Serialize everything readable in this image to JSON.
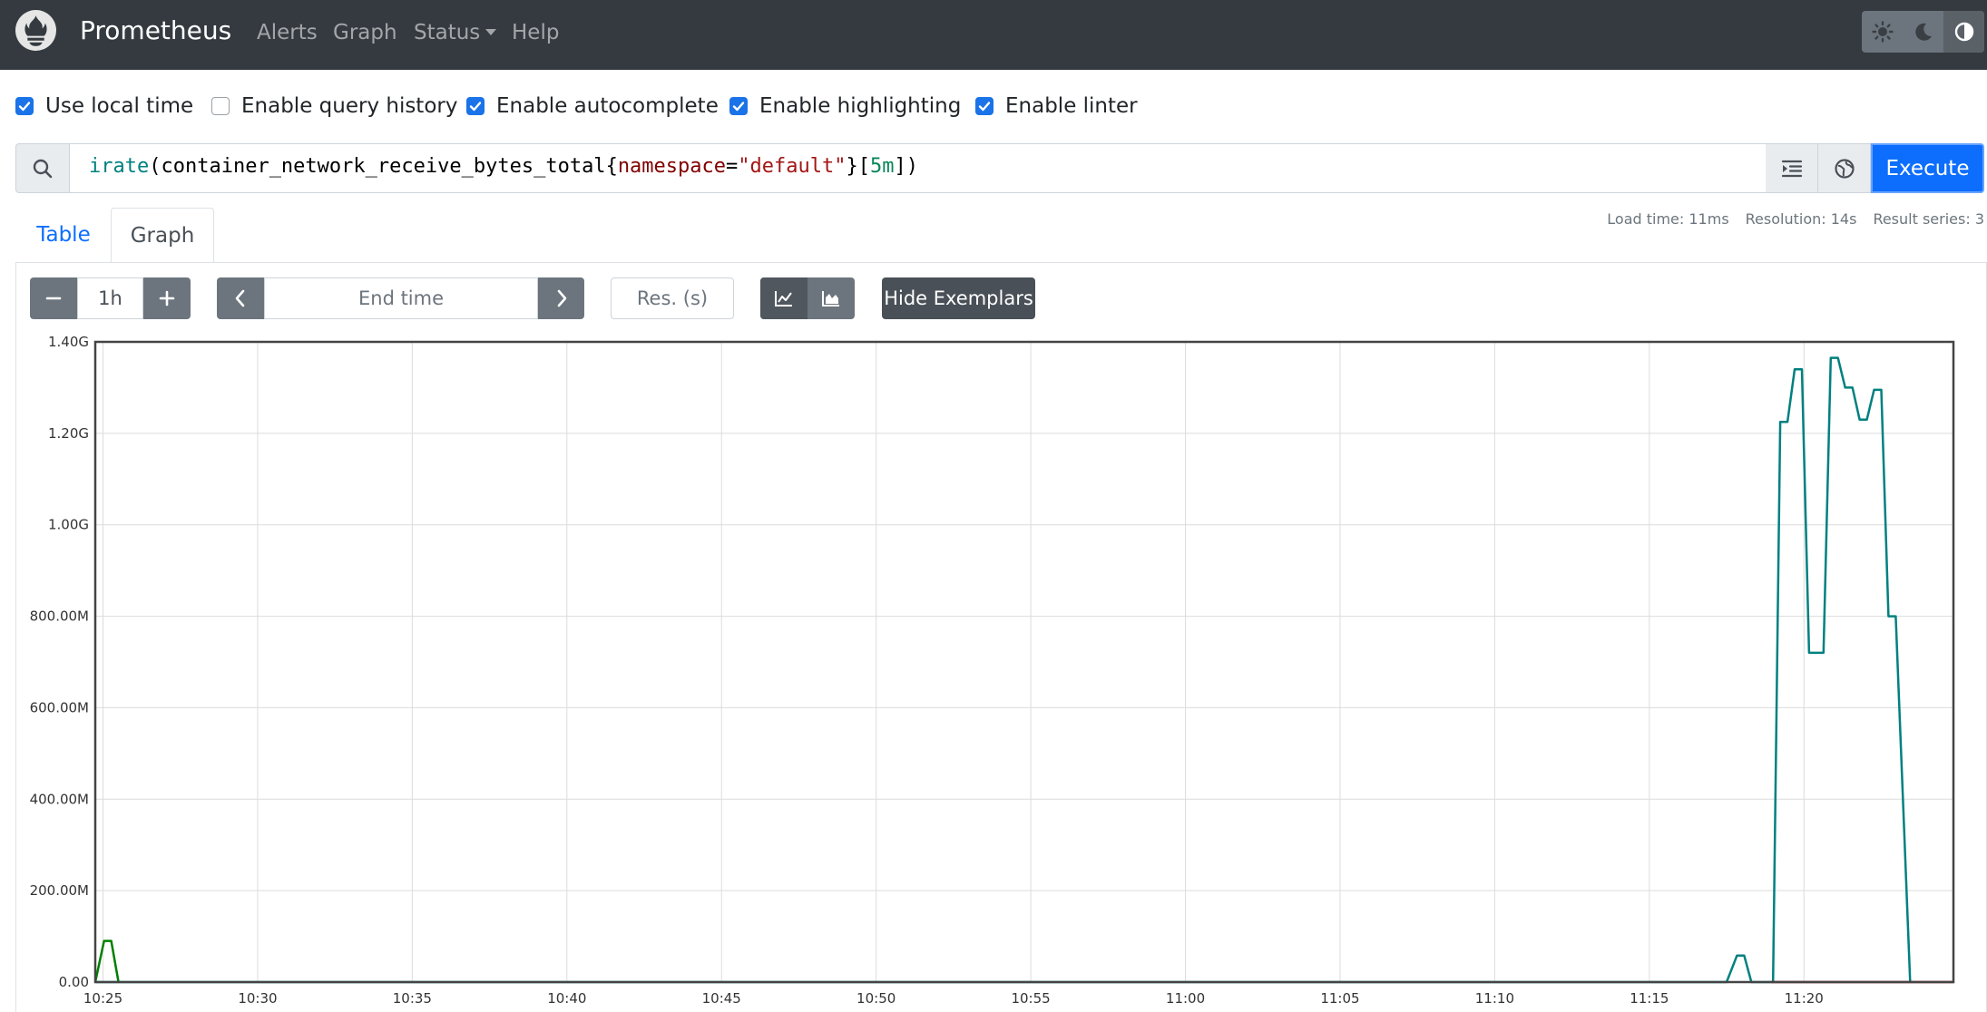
{
  "navbar": {
    "brand": "Prometheus",
    "links": [
      {
        "label": "Alerts"
      },
      {
        "label": "Graph"
      },
      {
        "label": "Status"
      },
      {
        "label": "Help"
      }
    ],
    "theme_buttons": [
      "sun-icon",
      "moon-icon",
      "contrast-icon"
    ],
    "active_theme": "contrast-icon"
  },
  "options": [
    {
      "label": "Use local time",
      "checked": true
    },
    {
      "label": "Enable query history",
      "checked": false
    },
    {
      "label": "Enable autocomplete",
      "checked": true
    },
    {
      "label": "Enable highlighting",
      "checked": true
    },
    {
      "label": "Enable linter",
      "checked": true
    }
  ],
  "query": {
    "fn": "irate",
    "open_paren": "(",
    "metric": "container_network_receive_bytes_total",
    "open_brace": "{",
    "label_name": "namespace",
    "eq": "=",
    "label_value": "\"default\"",
    "close_brace": "}",
    "open_bracket": "[",
    "range": "5m",
    "close": "])",
    "execute_label": "Execute"
  },
  "tabs": {
    "table": "Table",
    "graph": "Graph",
    "active": "graph"
  },
  "stats": {
    "load_time": "Load time: 11ms",
    "resolution": "Resolution: 14s",
    "result_series": "Result series: 3"
  },
  "controls": {
    "minus": "−",
    "range": "1h",
    "plus": "+",
    "end_time_placeholder": "End time",
    "res_placeholder": "Res. (s)",
    "hide_exemplars": "Hide Exemplars"
  },
  "chart_data": {
    "type": "line",
    "ylim": [
      0,
      1.4
    ],
    "y_unit": "G",
    "y_ticks": [
      "0.00",
      "200.00M",
      "400.00M",
      "600.00M",
      "800.00M",
      "1.00G",
      "1.20G",
      "1.40G"
    ],
    "x_ticks": [
      "10:25",
      "10:30",
      "10:35",
      "10:40",
      "10:45",
      "10:50",
      "10:55",
      "11:00",
      "11:05",
      "11:10",
      "11:15",
      "11:20"
    ],
    "xlim": [
      "10:24:45",
      "11:24:50"
    ],
    "grid": true,
    "series": [
      {
        "color": "#008000",
        "points": [
          [
            "10:24:45",
            0
          ],
          [
            "10:25:02",
            0.09
          ],
          [
            "10:25:16",
            0.09
          ],
          [
            "10:25:30",
            0
          ]
        ]
      },
      {
        "color": "#008080",
        "points": [
          [
            "10:24:45",
            0
          ],
          [
            "11:17:30",
            0
          ],
          [
            "11:17:50",
            0.058
          ],
          [
            "11:18:04",
            0.058
          ],
          [
            "11:18:18",
            0
          ],
          [
            "11:19:00",
            0
          ],
          [
            "11:19:14",
            1.225
          ],
          [
            "11:19:28",
            1.225
          ],
          [
            "11:19:42",
            1.34
          ],
          [
            "11:19:56",
            1.34
          ],
          [
            "11:20:10",
            0.72
          ],
          [
            "11:20:38",
            0.72
          ],
          [
            "11:20:52",
            1.365
          ],
          [
            "11:21:06",
            1.365
          ],
          [
            "11:21:20",
            1.3
          ],
          [
            "11:21:34",
            1.3
          ],
          [
            "11:21:48",
            1.23
          ],
          [
            "11:22:02",
            1.23
          ],
          [
            "11:22:16",
            1.295
          ],
          [
            "11:22:30",
            1.295
          ],
          [
            "11:22:44",
            0.8
          ],
          [
            "11:22:58",
            0.8
          ],
          [
            "11:23:26",
            0
          ]
        ]
      },
      {
        "color": "#8b0000",
        "points": [
          [
            "11:18:58",
            0
          ],
          [
            "11:24:50",
            0
          ]
        ]
      }
    ]
  }
}
